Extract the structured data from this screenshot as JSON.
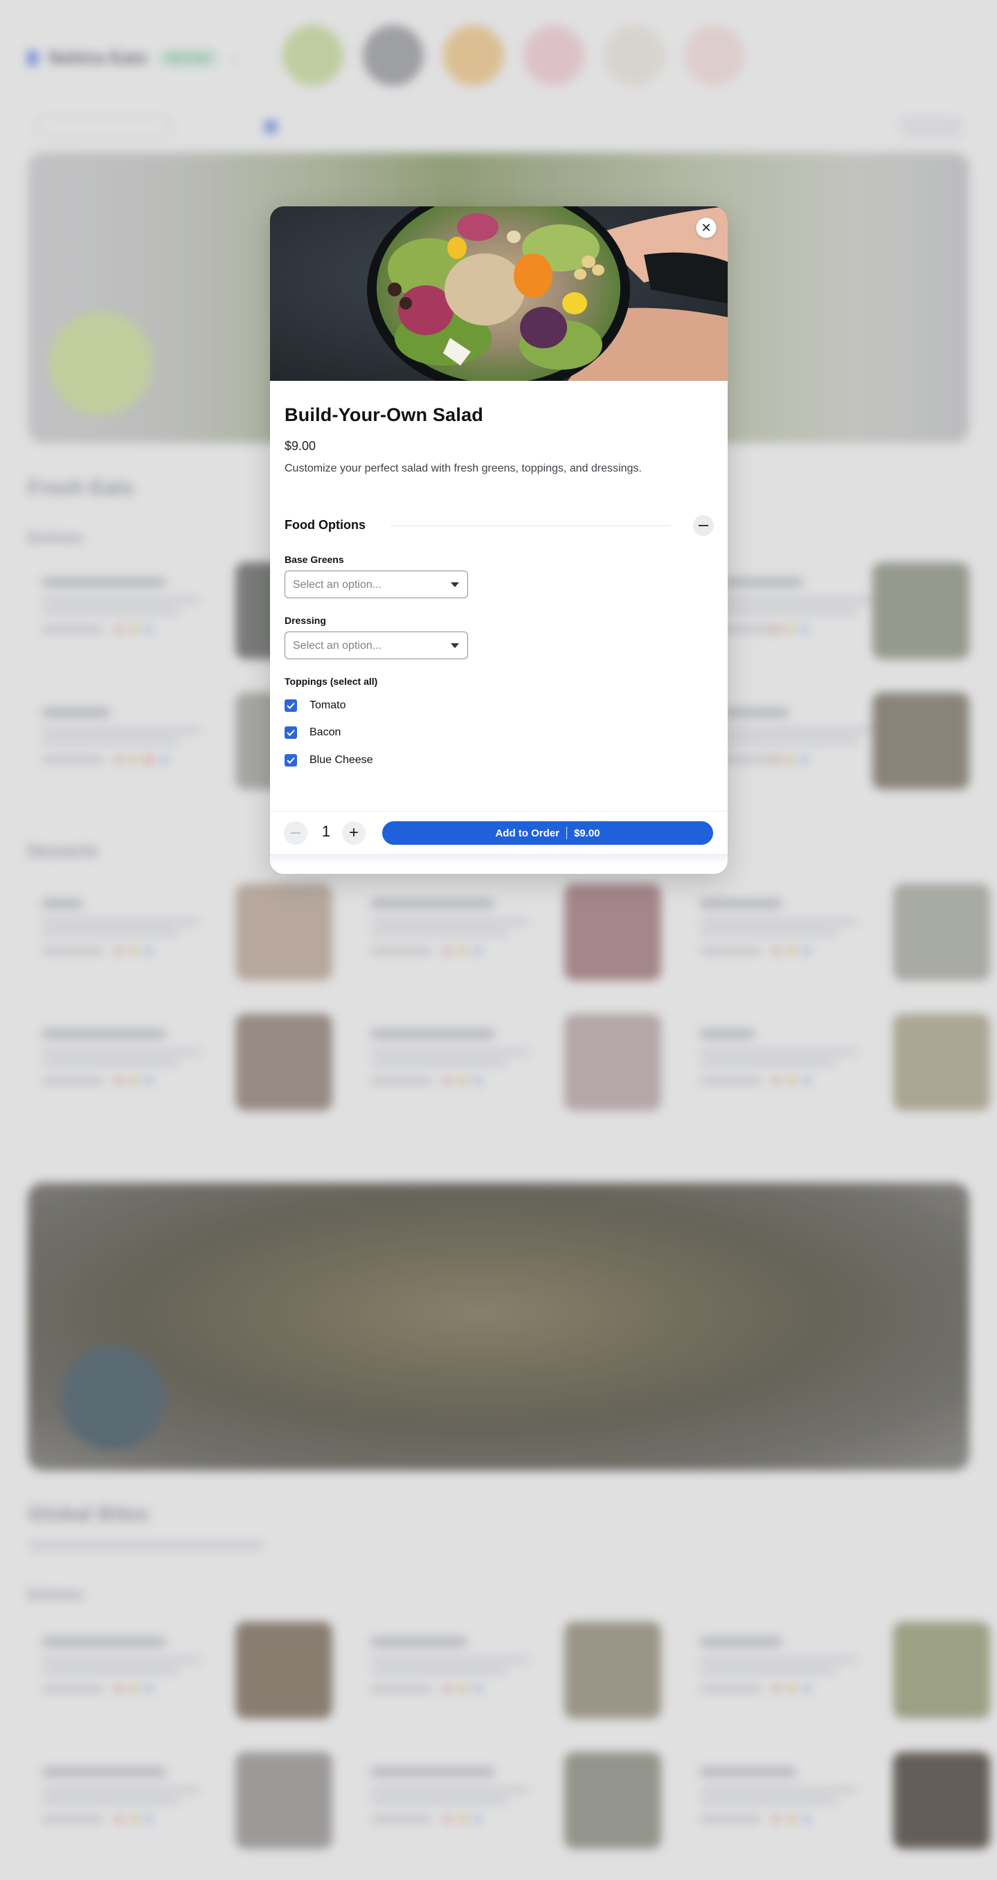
{
  "background": {
    "brand_name": "Nektra Eats",
    "brand_badge": "Open Now",
    "restaurant_logo_colors": [
      "#d4e6a9",
      "#a9aaad",
      "#f9d49a",
      "#f7c3cc",
      "#f3ece3",
      "#fbe3e0"
    ],
    "sections": [
      {
        "title": "Fresh Eats",
        "subsection": "Entrees"
      },
      {
        "title": "Desserts"
      },
      {
        "title": "Global Bites",
        "subsection": "Entrees"
      }
    ]
  },
  "modal": {
    "title": "Build-Your-Own Salad",
    "price": "$9.00",
    "description": "Customize your perfect salad with fresh greens, toppings, and dressings.",
    "options_heading": "Food Options",
    "fields": [
      {
        "label": "Base Greens",
        "placeholder": "Select an option..."
      },
      {
        "label": "Dressing",
        "placeholder": "Select an option..."
      }
    ],
    "toppings_label": "Toppings (select all)",
    "toppings": [
      {
        "label": "Tomato",
        "checked": true
      },
      {
        "label": "Bacon",
        "checked": true
      },
      {
        "label": "Blue Cheese",
        "checked": true
      }
    ],
    "quantity": "1",
    "add_button_label": "Add to Order",
    "add_button_price": "$9.00",
    "accent_color": "#1f61db"
  },
  "icons": {
    "close": "close-icon",
    "collapse": "minus-icon",
    "qty_decrease": "minus-icon",
    "qty_increase": "plus-icon",
    "dropdown": "caret-down-icon",
    "checkbox": "checkmark-icon"
  }
}
